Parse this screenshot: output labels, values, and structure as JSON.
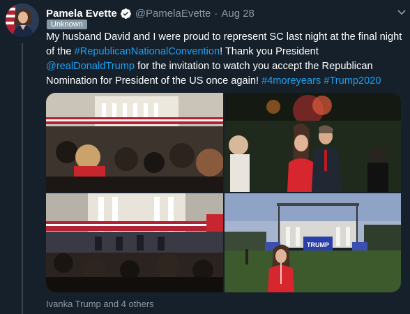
{
  "tweet": {
    "author_name": "Pamela Evette",
    "author_handle": "@PamelaEvette",
    "separator": "·",
    "date": "Aug 28",
    "badge": "Unknown",
    "text_part1": "My husband David and I were proud to represent SC last night at the final night of the ",
    "hashtag_rnc": "#RepublicanNationalConvention",
    "text_part2": "! Thank you President ",
    "mention": "@realDonaldTrump",
    "text_part3": " for the invitation to watch you accept the Republican Nomination for President of the US once again! ",
    "hashtag_4more": "#4moreyears",
    "text_part4": " ",
    "hashtag_trump2020": "#Trump2020",
    "liked_by": "Ivanka Trump and 4 others"
  },
  "media": {
    "photo4_sign": "TRUMP"
  },
  "colors": {
    "background": "#15202b",
    "link": "#1da1f2",
    "muted": "#8899a6",
    "verified": "#ffffff"
  },
  "icons": {
    "verified": "verified-badge-icon",
    "more": "chevron-down-icon"
  }
}
